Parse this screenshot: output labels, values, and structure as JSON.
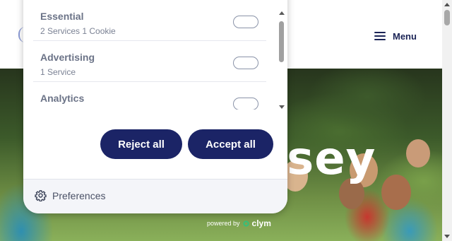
{
  "header": {
    "menu_label": "Menu",
    "menu_icon": "hamburger-icon"
  },
  "hero": {
    "title": "New Jersey"
  },
  "consent": {
    "services": [
      {
        "name": "Essential",
        "description": "2 Services 1 Cookie"
      },
      {
        "name": "Advertising",
        "description": "1 Service"
      },
      {
        "name": "Analytics",
        "description": ""
      }
    ],
    "buttons": {
      "reject": "Reject all",
      "accept": "Accept all"
    },
    "preferences_label": "Preferences",
    "preferences_icon": "gear-icon",
    "powered_by": "powered by",
    "powered_brand": "clym"
  },
  "colors": {
    "primary": "#1b2466",
    "toggle_border": "#8a93a8",
    "text_muted": "#6b7387"
  }
}
